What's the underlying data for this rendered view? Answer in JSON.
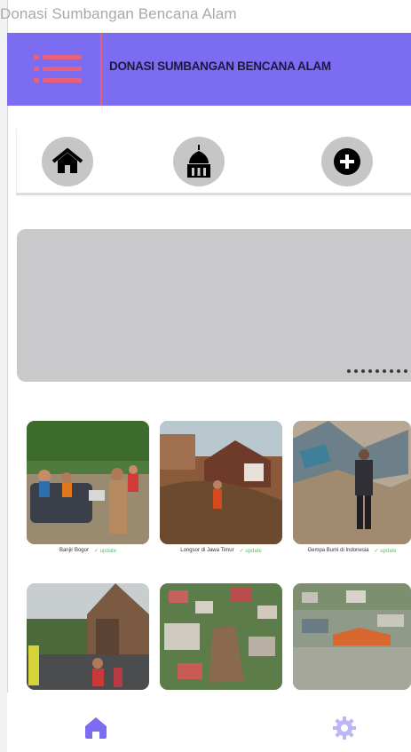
{
  "window": {
    "title": "Donasi Sumbangan Bencana Alam"
  },
  "header": {
    "title": "DONASI SUMBANGAN BENCANA ALAM",
    "menu_icon": "menu-icon",
    "accent": "#7b6cf1",
    "menu_color": "#e8607a"
  },
  "nav": [
    {
      "icon": "home-icon"
    },
    {
      "icon": "mosque-icon"
    },
    {
      "icon": "add-circle-icon"
    }
  ],
  "slider": {
    "dot_count": 9
  },
  "gallery": [
    {
      "place": "Banjir Bogor",
      "status": "✓ update"
    },
    {
      "place": "Longsor di Jawa Timur",
      "status": "✓ update"
    },
    {
      "place": "Gempa Bumi di Indonesia",
      "status": "✓ update"
    },
    {
      "place": "",
      "status": ""
    },
    {
      "place": "",
      "status": ""
    },
    {
      "place": "",
      "status": ""
    }
  ],
  "bottom_nav": [
    {
      "icon": "home-icon",
      "active": true
    },
    {
      "icon": "gear-icon",
      "active": false
    }
  ]
}
